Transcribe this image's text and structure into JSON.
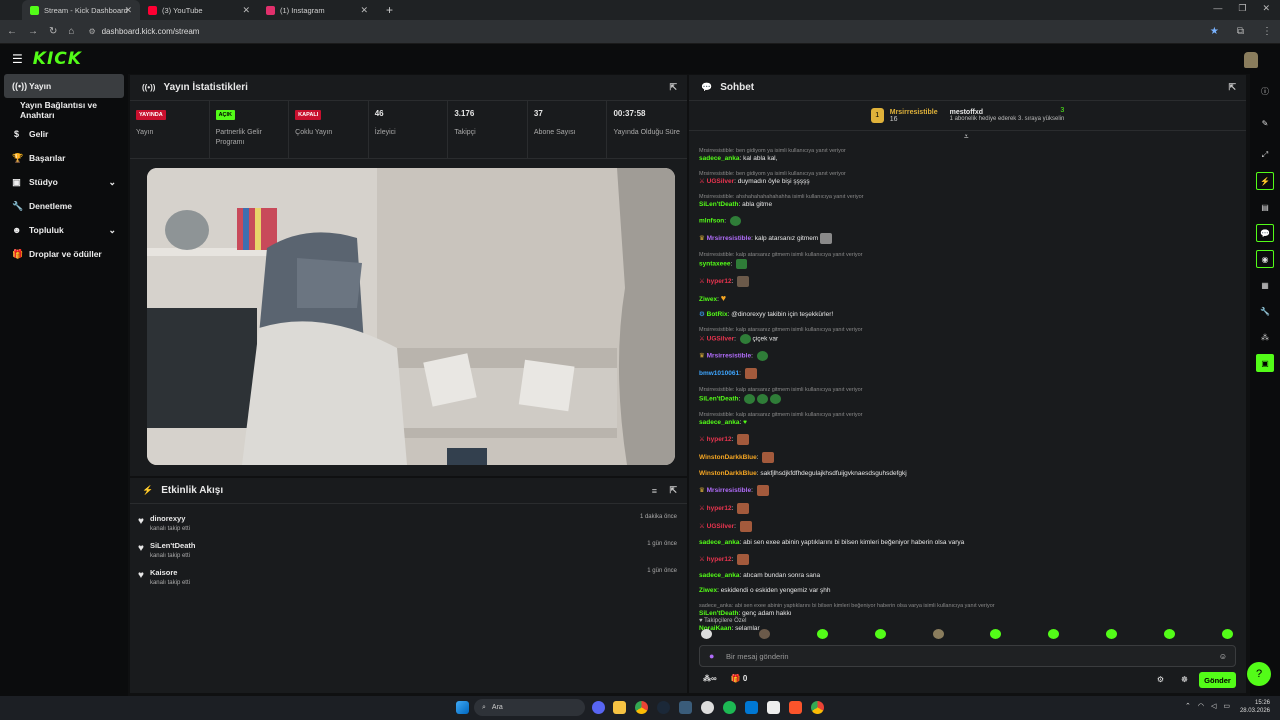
{
  "browser": {
    "tabs": [
      {
        "title": "Stream - Kick Dashboard",
        "color": "#53fc18"
      },
      {
        "title": "(3) YouTube",
        "color": "#ff0033"
      },
      {
        "title": "(1) Instagram",
        "color": "#e1306c"
      }
    ],
    "url": "dashboard.kick.com/stream"
  },
  "logo": "KICK",
  "sidebar": {
    "items": [
      {
        "label": "Yayın",
        "icon": "broadcast-icon"
      },
      {
        "label": "Yayın Bağlantısı ve Anahtarı",
        "icon": ""
      },
      {
        "label": "Gelir",
        "icon": "dollar-icon"
      },
      {
        "label": "Başarılar",
        "icon": "trophy-icon"
      },
      {
        "label": "Stüdyo",
        "icon": "studio-icon"
      },
      {
        "label": "Denetleme",
        "icon": "wrench-icon"
      },
      {
        "label": "Topluluk",
        "icon": "community-icon"
      },
      {
        "label": "Droplar ve ödüller",
        "icon": "gift-icon"
      }
    ]
  },
  "stats_panel": {
    "title": "Yayın İstatistikleri",
    "stats": [
      {
        "value": "YAYINDA",
        "label": "Yayın",
        "badge": true,
        "bg": "#c8102e",
        "fg": "#ffffff"
      },
      {
        "value": "AÇIK",
        "label": "Partnerlik Gelir Programı",
        "badge": true,
        "bg": "#53fc18",
        "fg": "#000000"
      },
      {
        "value": "KAPALI",
        "label": "Çoklu Yayın",
        "badge": true,
        "bg": "#c8102e",
        "fg": "#ffffff"
      },
      {
        "value": "46",
        "label": "İzleyici",
        "badge": false
      },
      {
        "value": "3.176",
        "label": "Takipçi",
        "badge": false
      },
      {
        "value": "37",
        "label": "Abone Sayısı",
        "badge": false
      },
      {
        "value": "00:37:58",
        "label": "Yayında Olduğu Süre",
        "badge": false
      }
    ]
  },
  "events_panel": {
    "title": "Etkinlik Akışı",
    "events": [
      {
        "name": "dinorexyy",
        "action": "kanalı takip etti",
        "time": "1 dakika önce"
      },
      {
        "name": "SiLen'tDeath",
        "action": "kanalı takip etti",
        "time": "1 gün önce"
      },
      {
        "name": "Kaisore",
        "action": "kanalı takip etti",
        "time": "1 gün önce"
      }
    ]
  },
  "chat": {
    "title": "Sohbet",
    "pinned": {
      "top_user": "Mrsirresistible",
      "top_count": "16",
      "gifter": "mestoffxd",
      "gifter_text": "1 abonelik hediye ederek 3. sıraya yükselin",
      "gifter_count": "3"
    },
    "messages": [
      {
        "reply": "Mrsirresistible: ben gidiyom ya isimli kullanıcıya yanıt veriyor",
        "user": "sadece_anka",
        "color": "#53fc18",
        "text": "kal abla kal,"
      },
      {
        "reply": "Mrsirresistible: ben gidiyom ya isimli kullanıcıya yanıt veriyor",
        "user": "UGSilver",
        "color": "#e9344f",
        "text": "duymadın öyle bişi şşşşş"
      },
      {
        "reply": "Mrsirresistible: ahshahahahahahahha isimli kullanıcıya yanıt veriyor",
        "user": "SiLen'tDeath",
        "color": "#53fc18",
        "text": "abla gitme"
      },
      {
        "reply": "",
        "user": "mlnfson",
        "color": "#53fc18",
        "text": ""
      },
      {
        "reply": "",
        "user": "Mrsirresistible",
        "color": "#b06cf9",
        "text": "kalp atarsanız gitmem"
      },
      {
        "reply": "Mrsirresistible: kalp atarsanız gitmem isimli kullanıcıya yanıt veriyor",
        "user": "syntaxeee",
        "color": "#53fc18",
        "text": ""
      },
      {
        "reply": "",
        "user": "hyper12",
        "color": "#e9344f",
        "text": ""
      },
      {
        "reply": "",
        "user": "Ziwex",
        "color": "#53fc18",
        "text": ""
      },
      {
        "reply": "",
        "user": "BotRix",
        "color": "#53fc18",
        "text": "@dinorexyy takibin için teşekkürler!"
      },
      {
        "reply": "Mrsirresistible: kalp atarsanız gitmem isimli kullanıcıya yanıt veriyor",
        "user": "UGSilver",
        "color": "#e9344f",
        "text": "çiçek var"
      },
      {
        "reply": "",
        "user": "Mrsirresistible",
        "color": "#b06cf9",
        "text": ""
      },
      {
        "reply": "",
        "user": "bmw1010061",
        "color": "#3ea6ff",
        "text": ""
      },
      {
        "reply": "Mrsirresistible: kalp atarsanız gitmem isimli kullanıcıya yanıt veriyor",
        "user": "SiLen'tDeath",
        "color": "#53fc18",
        "text": ""
      },
      {
        "reply": "Mrsirresistible: kalp atarsanız gitmem isimli kullanıcıya yanıt veriyor",
        "user": "sadece_anka",
        "color": "#53fc18",
        "text": ""
      },
      {
        "reply": "",
        "user": "hyper12",
        "color": "#e9344f",
        "text": ""
      },
      {
        "reply": "",
        "user": "WinstonDarkkBlue",
        "color": "#f5a623",
        "text": ""
      },
      {
        "reply": "",
        "user": "WinstonDarkkBlue",
        "color": "#f5a623",
        "text": "sakfjlhsdjkfdfhdegulajkhsdfuijgvknaesdsguhsdefgkj"
      },
      {
        "reply": "",
        "user": "Mrsirresistible",
        "color": "#b06cf9",
        "text": ""
      },
      {
        "reply": "",
        "user": "hyper12",
        "color": "#e9344f",
        "text": ""
      },
      {
        "reply": "",
        "user": "UGSilver",
        "color": "#e9344f",
        "text": ""
      },
      {
        "reply": "",
        "user": "sadece_anka",
        "color": "#53fc18",
        "text": "abi sen exee abinin yaptıklarını bi bilsen kimleri beğeniyor haberin olsa varya"
      },
      {
        "reply": "",
        "user": "hyper12",
        "color": "#e9344f",
        "text": ""
      },
      {
        "reply": "",
        "user": "sadece_anka",
        "color": "#53fc18",
        "text": "atıcam bundan sonra sana"
      },
      {
        "reply": "",
        "user": "Ziwex",
        "color": "#53fc18",
        "text": "eskidendi o eskiden yengemiz var şhh"
      },
      {
        "reply": "sadece_anka: abi sen exee abinin yaptıklarını bi bilsen kimleri beğeniyor haberin olsa varya isimli kullanıcıya yanıt veriyor",
        "user": "SiLen'tDeath",
        "color": "#53fc18",
        "text": "genç adam hakkı"
      },
      {
        "reply": "",
        "user": "NoraiKaan",
        "color": "#53fc18",
        "text": "selamlar"
      }
    ],
    "emote_label": "Takipçilere Özel",
    "input_placeholder": "Bir mesaj gönderin",
    "points": "∞",
    "gift_count": "0",
    "send_label": "Gönder"
  },
  "taskbar": {
    "search_placeholder": "Ara",
    "time": "15:26",
    "date": "28.03.2026"
  },
  "colors": {
    "accent": "#53fc18",
    "panel": "#191b1d",
    "background": "#0f1011"
  }
}
